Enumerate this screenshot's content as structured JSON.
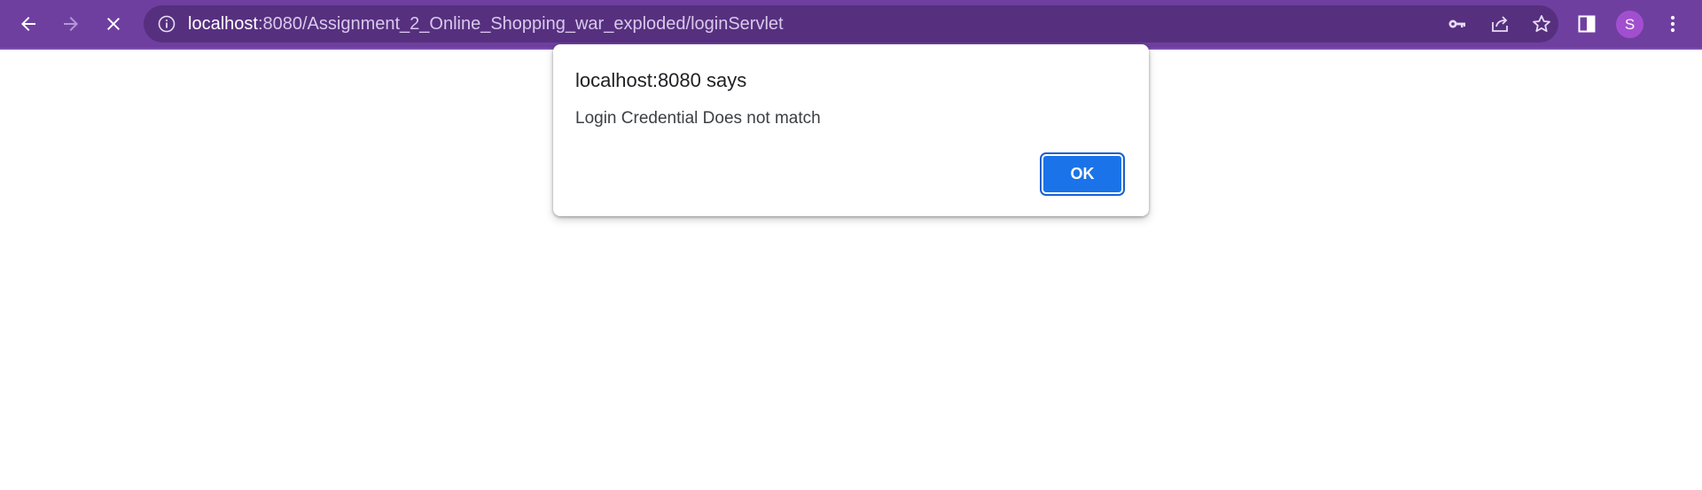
{
  "browser": {
    "url_host": "localhost",
    "url_rest": ":8080/Assignment_2_Online_Shopping_war_exploded/loginServlet",
    "profile_initial": "S",
    "theme_color": "#6f3fa0",
    "omnibox_color": "#56307f",
    "icons": {
      "back": "arrow-left-icon",
      "forward": "arrow-right-icon",
      "stop": "close-icon",
      "site_info": "info-icon",
      "password": "key-icon",
      "share": "share-icon",
      "bookmark": "star-icon",
      "side_panel": "side-panel-icon",
      "menu": "kebab-menu-icon"
    }
  },
  "dialog": {
    "title": "localhost:8080 says",
    "message": "Login Credential Does not match",
    "ok_label": "OK",
    "button_color": "#1a73e8"
  }
}
